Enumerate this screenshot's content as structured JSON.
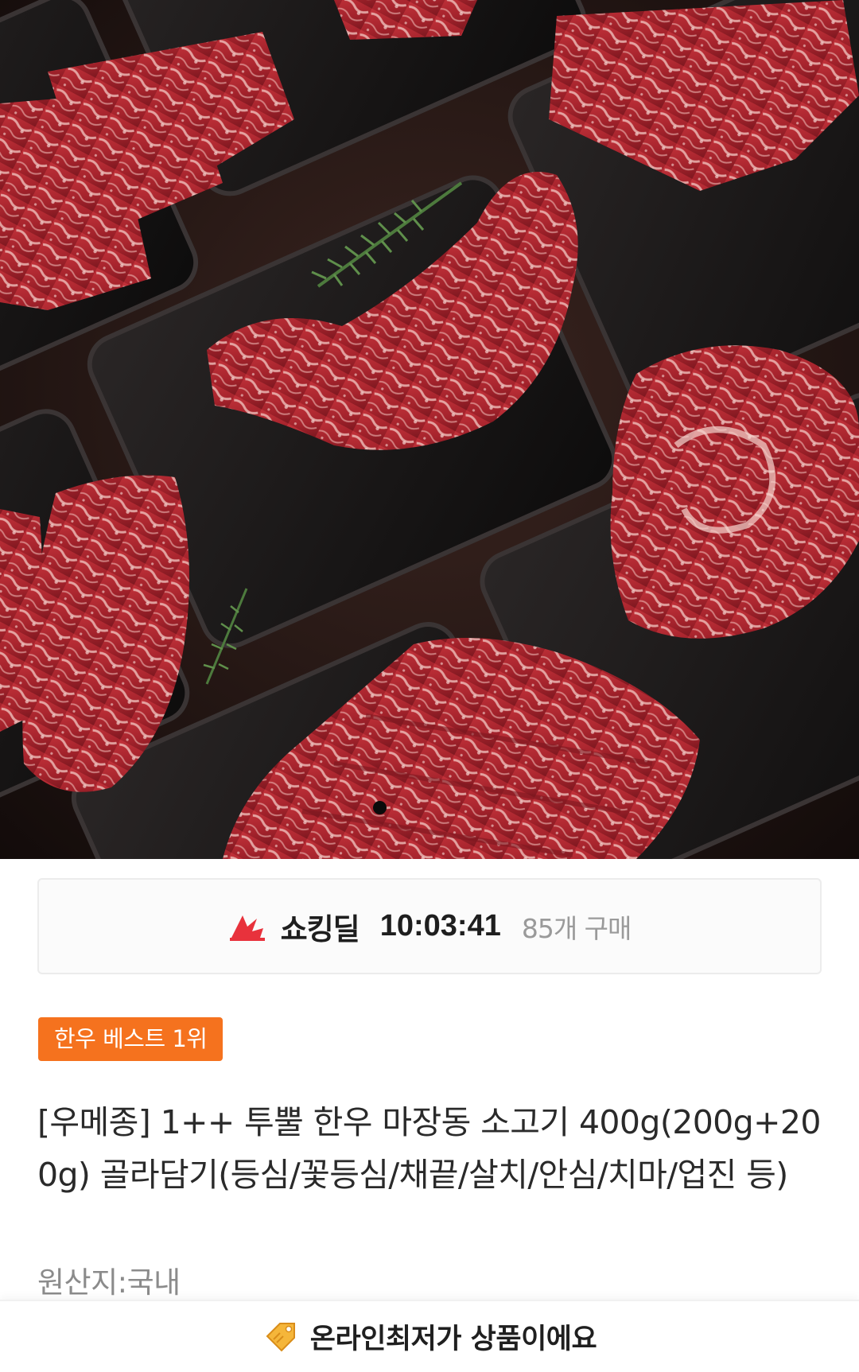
{
  "hero": {
    "image_alt": "한우 포장 이미지",
    "carousel_active_index": 1
  },
  "deal": {
    "label": "쇼킹딜",
    "timer": "10:03:41",
    "purchase_count": "85개 구매",
    "icon": "shocking-deal-flash-icon",
    "accent_color": "#e8323c"
  },
  "badge": {
    "text": "한우 베스트 1위",
    "color": "#f5721e"
  },
  "product": {
    "title": "[우메종] 1++ 투뿔 한우 마장동 소고기 400g(200g+200g) 골라담기(등심/꽃등심/채끝/살치/안심/치마/업진 등)",
    "origin": "원산지:국내"
  },
  "notice": {
    "icon": "price-tag-icon",
    "text": "온라인최저가 상품이에요"
  }
}
